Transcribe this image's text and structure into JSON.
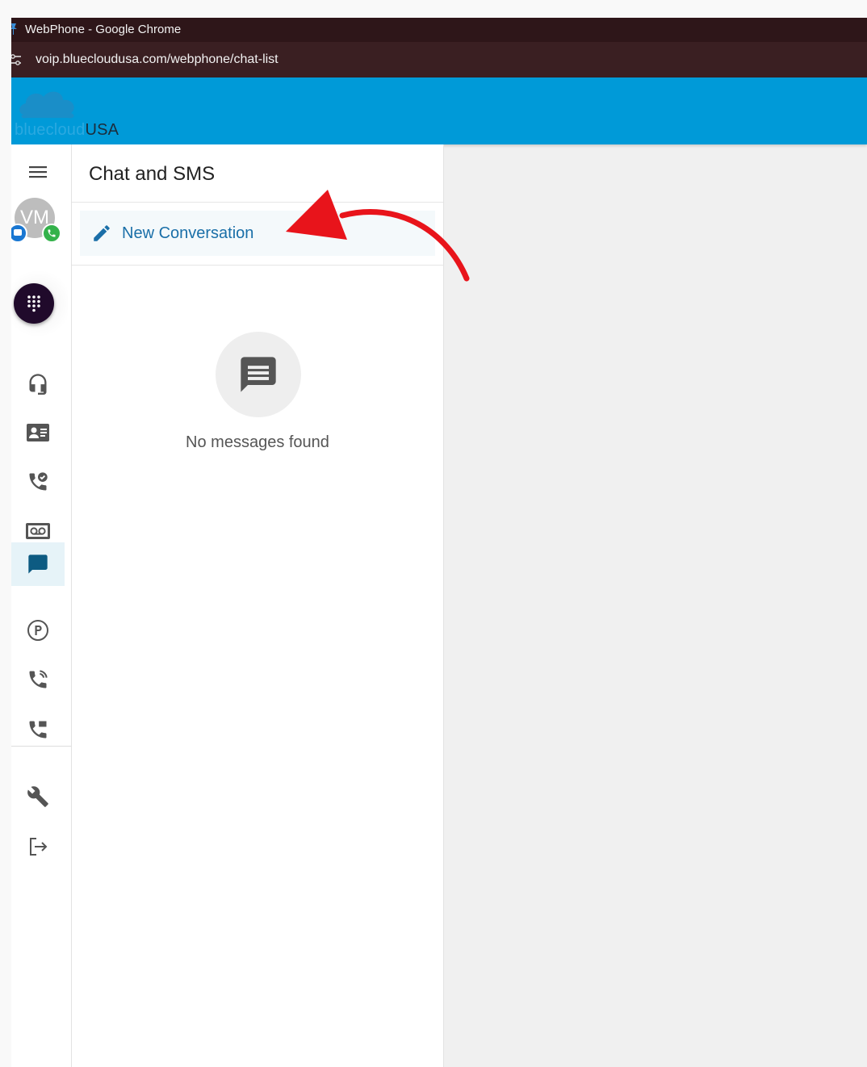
{
  "browser": {
    "window_title": "WebPhone - Google Chrome",
    "url": "voip.bluecloudusa.com/webphone/chat-list"
  },
  "brand": {
    "logo_prefix": "bluecloud",
    "logo_suffix": "USA",
    "header_color": "#009ad8"
  },
  "user": {
    "initials": "VM"
  },
  "rail": {
    "items": [
      {
        "icon": "menu-icon"
      },
      {
        "icon": "dialpad-icon"
      },
      {
        "icon": "headset-icon"
      },
      {
        "icon": "contacts-icon"
      },
      {
        "icon": "call-history-icon"
      },
      {
        "icon": "voicemail-icon"
      },
      {
        "icon": "chat-icon",
        "active": true
      },
      {
        "icon": "parking-icon"
      },
      {
        "icon": "call-queue-icon"
      },
      {
        "icon": "call-forward-icon"
      },
      {
        "icon": "settings-wrench-icon"
      },
      {
        "icon": "logout-icon"
      }
    ]
  },
  "chat": {
    "title": "Chat and SMS",
    "new_conversation_label": "New Conversation",
    "empty_message": "No messages found"
  },
  "colors": {
    "accent_link": "#1a6fa8",
    "annotation_arrow": "#e8141b"
  }
}
